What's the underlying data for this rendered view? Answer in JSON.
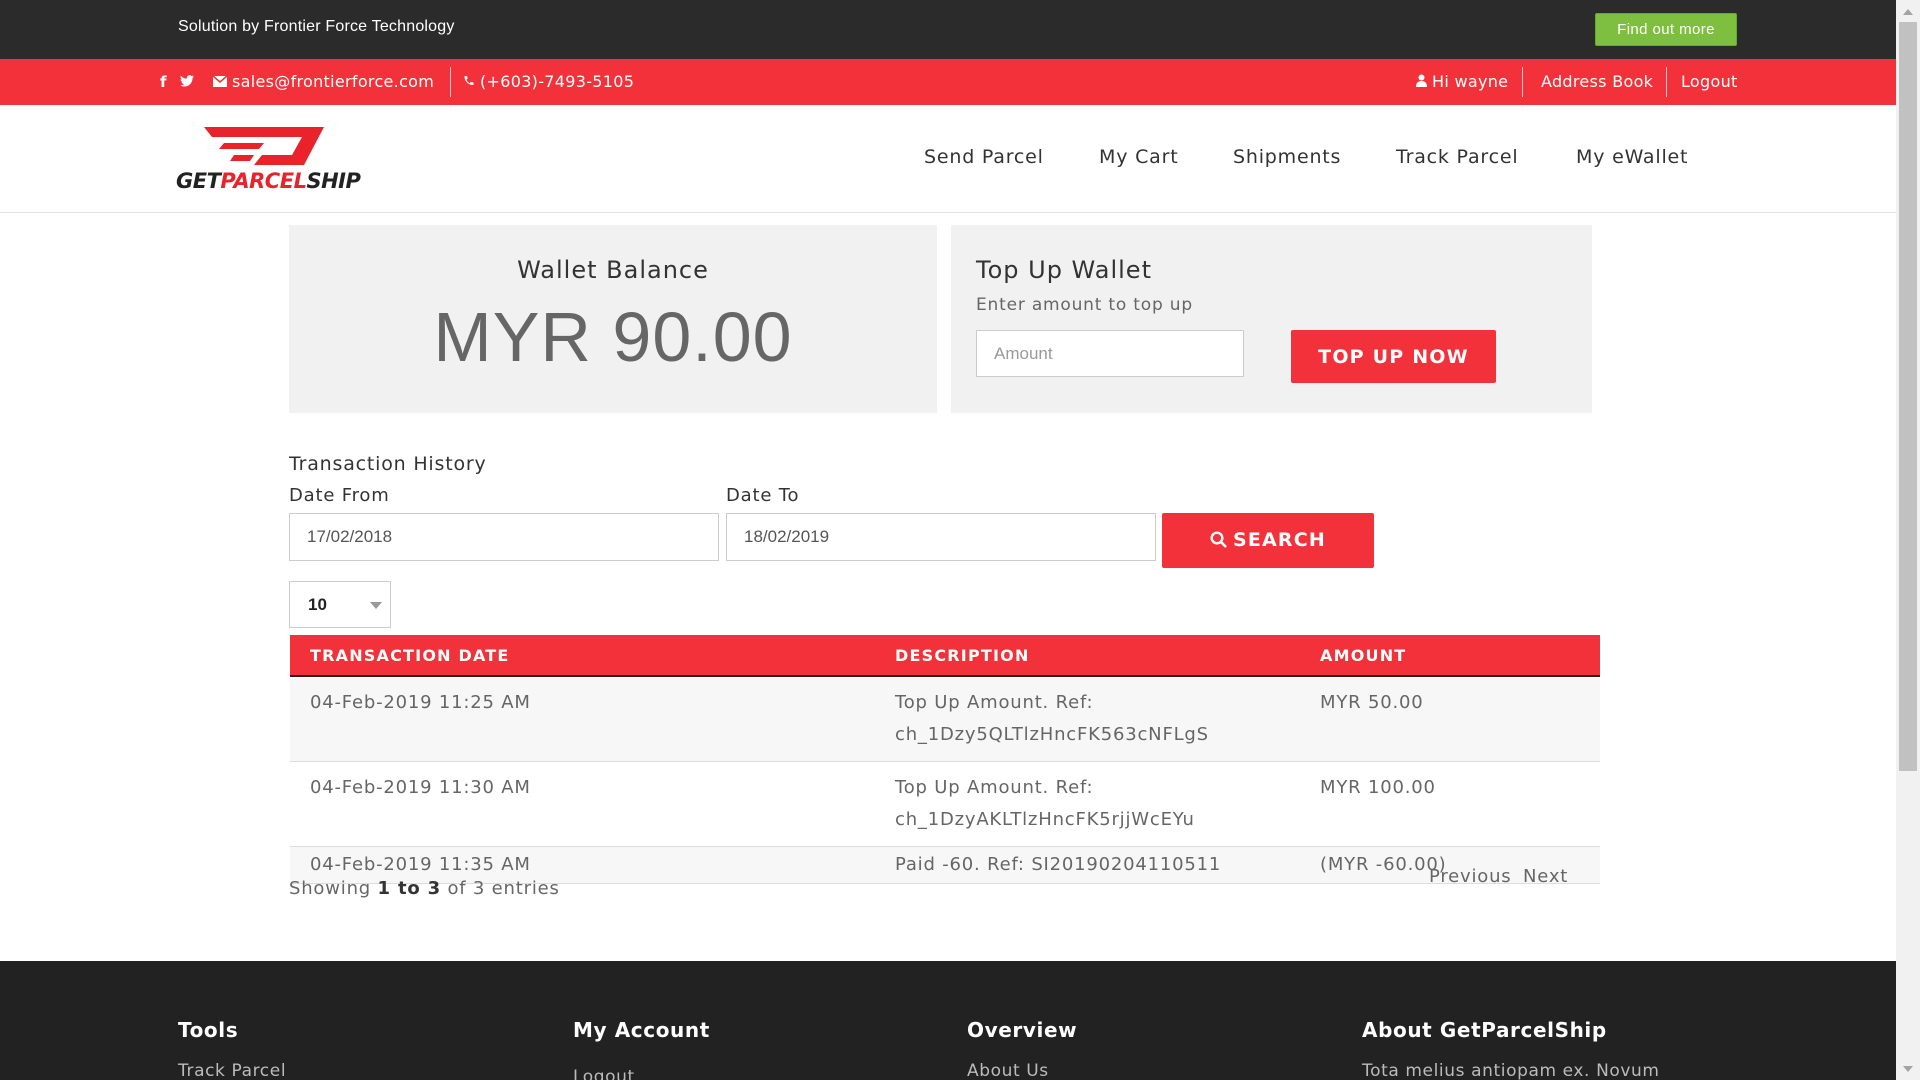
{
  "topbar": {
    "brand_text": "Solution by Frontier Force Technology",
    "find_out_more": "Find out more"
  },
  "contact": {
    "social_icons": [
      "facebook-icon",
      "twitter-icon"
    ],
    "email": "sales@frontierforce.com",
    "phone": "(+603)-7493-5105",
    "user": "Hi wayne",
    "address_book": "Address Book",
    "logout": "Logout"
  },
  "logo": {
    "part1": "GET",
    "part2": "PARCEL",
    "part3": "SHIP"
  },
  "nav": [
    "Send Parcel",
    "My Cart",
    "Shipments",
    "Track Parcel",
    "My eWallet"
  ],
  "wallet": {
    "label": "Wallet Balance",
    "balance": "MYR 90.00"
  },
  "topup": {
    "title": "Top Up Wallet",
    "subtitle": "Enter amount to top up",
    "amount_placeholder": "Amount",
    "button": "TOP UP NOW"
  },
  "history": {
    "title": "Transaction History",
    "date_from_label": "Date From",
    "date_to_label": "Date To",
    "date_from": "17/02/2018",
    "date_to": "18/02/2019",
    "search_button": "SEARCH",
    "page_size": "10",
    "columns": [
      "TRANSACTION DATE",
      "DESCRIPTION",
      "AMOUNT"
    ],
    "rows": [
      {
        "date": "04-Feb-2019 11:25 AM",
        "desc_line1": "Top Up Amount. Ref:",
        "desc_line2": "ch_1Dzy5QLTlzHncFK563cNFLgS",
        "amount": "MYR 50.00"
      },
      {
        "date": "04-Feb-2019 11:30 AM",
        "desc_line1": "Top Up Amount. Ref:",
        "desc_line2": "ch_1DzyAKLTlzHncFK5rjjWcEYu",
        "amount": "MYR 100.00"
      },
      {
        "date": "04-Feb-2019 11:35 AM",
        "desc_line1": "Paid -60. Ref: SI20190204110511",
        "desc_line2": "",
        "amount": "(MYR -60.00)"
      }
    ],
    "showing_prefix": "Showing",
    "showing_range": "1 to 3",
    "showing_suffix": "of 3 entries",
    "previous": "Previous",
    "next": "Next"
  },
  "footer": {
    "columns": [
      {
        "title": "Tools",
        "first_link": "Track Parcel"
      },
      {
        "title": "My Account",
        "first_link": "Logout"
      },
      {
        "title": "Overview",
        "first_link": "About Us"
      },
      {
        "title": "About GetParcelShip",
        "first_link": "Tota melius antiopam ex. Novum"
      }
    ]
  },
  "colors": {
    "accent_red": "#f2313a",
    "find_out_more_green": "#7fbf3f",
    "dark_bar": "#2b2b2b",
    "footer_bg": "#222222"
  }
}
